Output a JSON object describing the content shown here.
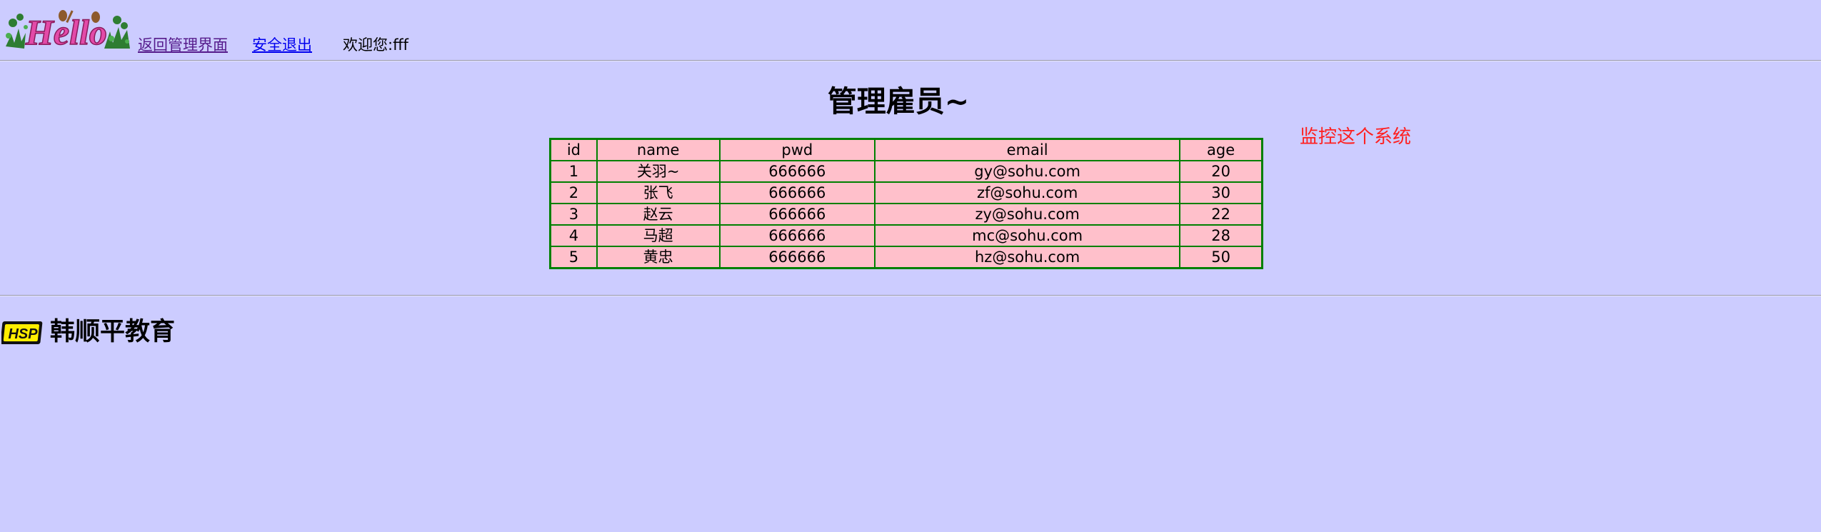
{
  "header": {
    "logo_text": "Hello",
    "back_link": "返回管理界面",
    "logout_link": "安全退出",
    "welcome_text": "欢迎您:fff"
  },
  "main": {
    "title": "管理雇员~",
    "monitor_link": "监控这个系统",
    "table": {
      "columns": [
        "id",
        "name",
        "pwd",
        "email",
        "age"
      ],
      "rows": [
        [
          "1",
          "关羽~",
          "666666",
          "gy@sohu.com",
          "20"
        ],
        [
          "2",
          "张飞",
          "666666",
          "zf@sohu.com",
          "30"
        ],
        [
          "3",
          "赵云",
          "666666",
          "zy@sohu.com",
          "22"
        ],
        [
          "4",
          "马超",
          "666666",
          "mc@sohu.com",
          "28"
        ],
        [
          "5",
          "黄忠",
          "666666",
          "hz@sohu.com",
          "50"
        ]
      ]
    }
  },
  "footer": {
    "logo_text": "HSP",
    "brand_text": "韩顺平教育"
  },
  "colors": {
    "background": "#ccccff",
    "table_background": "#ffc0cb",
    "table_border": "#008000",
    "monitor_link": "#ff2020",
    "footer_logo_bg": "#111111",
    "footer_logo_text": "#ffee00"
  }
}
